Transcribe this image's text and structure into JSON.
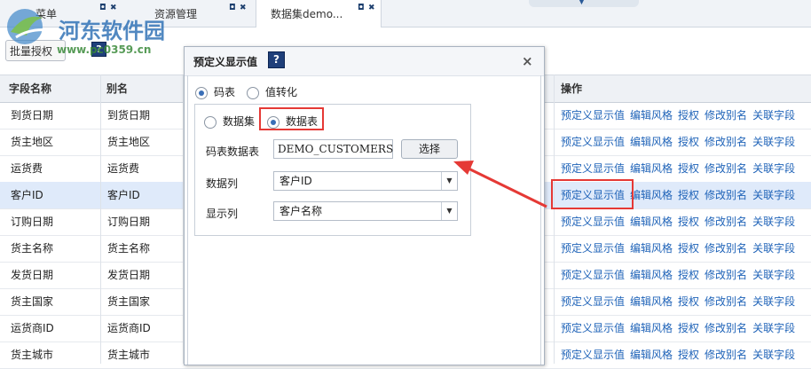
{
  "tabs": [
    {
      "label": "菜单"
    },
    {
      "label": "资源管理"
    },
    {
      "label": "数据集demo..."
    }
  ],
  "tab_icons": {
    "restore": "restore-icon",
    "close": "close-icon"
  },
  "watermark": {
    "title": "河东软件园",
    "url": "www.pc0359.cn"
  },
  "toolbar": {
    "batch_button": "批量授权"
  },
  "grid": {
    "headers": {
      "field": "字段名称",
      "alias": "别名",
      "actions": "操作"
    },
    "action_labels": [
      "预定义显示值",
      "编辑风格",
      "授权",
      "修改别名",
      "关联字段"
    ],
    "rows": [
      {
        "field": "到货日期",
        "alias": "到货日期"
      },
      {
        "field": "货主地区",
        "alias": "货主地区"
      },
      {
        "field": "运货费",
        "alias": "运货费"
      },
      {
        "field": "客户ID",
        "alias": "客户ID"
      },
      {
        "field": "订购日期",
        "alias": "订购日期"
      },
      {
        "field": "货主名称",
        "alias": "货主名称"
      },
      {
        "field": "发货日期",
        "alias": "发货日期"
      },
      {
        "field": "货主国家",
        "alias": "货主国家"
      },
      {
        "field": "运货商ID",
        "alias": "运货商ID"
      },
      {
        "field": "货主城市",
        "alias": "货主城市"
      }
    ]
  },
  "dialog": {
    "title": "预定义显示值",
    "close": "×",
    "mode_options": [
      "码表",
      "值转化"
    ],
    "source_options": [
      "数据集",
      "数据表"
    ],
    "table_label": "码表数据表",
    "table_value": "DEMO_CUSTOMERS",
    "select_button": "选择",
    "data_col_label": "数据列",
    "data_col_value": "客户ID",
    "display_col_label": "显示列",
    "display_col_value": "客户名称"
  },
  "colors": {
    "link": "#1f63b8",
    "highlight": "#e53935",
    "selected_row": "#dfeafa"
  }
}
